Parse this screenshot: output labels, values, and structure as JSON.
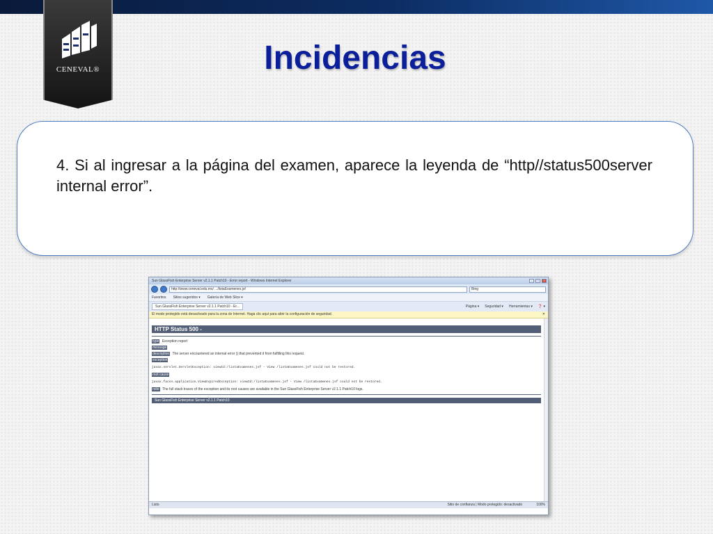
{
  "slide": {
    "title": "Incidencias",
    "logo_text": "CENEVAL®",
    "body_text": "4. Si al ingresar a la página del examen, aparece la leyenda de “http//status500server internal error”."
  },
  "browser": {
    "window_title": "Sun GlassFish Enterprise Server v2.1.1 Patch10 - Error report - Windows Internet Explorer",
    "url": "http://www.ceneval.edu.mx/ .../listaExamenes.jsf",
    "search_placeholder": "Bing",
    "favorites": [
      "Favoritos",
      "Sitios sugeridos ▾",
      "Galería de Web Slice ▾"
    ],
    "tab_label": "Sun GlassFish Enterprise Server v2.1.1 Patch10 - Er...",
    "commands": [
      "Página ▾",
      "Seguridad ▾",
      "Herramientas ▾",
      "❓ ▾"
    ],
    "info_bar": "El modo protegido está desactivado para la zona de Internet. Haga clic aquí para abrir la configuración de seguridad.",
    "info_close": "✕",
    "content": {
      "heading": "HTTP Status 500 -",
      "type_label": "type",
      "type_value": "Exception report",
      "message_label": "message",
      "description_label": "description",
      "description_value": "The server encountered an internal error () that prevented it from fulfilling this request.",
      "exception_label": "exception",
      "exception_value": "javax.servlet.ServletException: viewId:/listaExamenes.jsf - View /listaExamenes.jsf could not be restored.",
      "root_cause_label": "root cause",
      "root_cause_value": "javax.faces.application.ViewExpiredException: viewId:/listaExamenes.jsf - View /listaExamenes.jsf could not be restored.",
      "note_label": "note",
      "note_value": "The full stack traces of the exception and its root causes are available in the Sun GlassFish Enterprise Server v2.1.1 Patch10 logs.",
      "footer": "Sun GlassFish Enterprise Server v2.1.1 Patch10"
    },
    "status": {
      "left": "Listo",
      "zone": "Sitio de confianza | Modo protegido: desactivado",
      "zoom": "100%"
    }
  },
  "colors": {
    "title": "#0c1f9a",
    "callout_border": "#4d7bc1",
    "top_bar": "#0c2d63"
  }
}
